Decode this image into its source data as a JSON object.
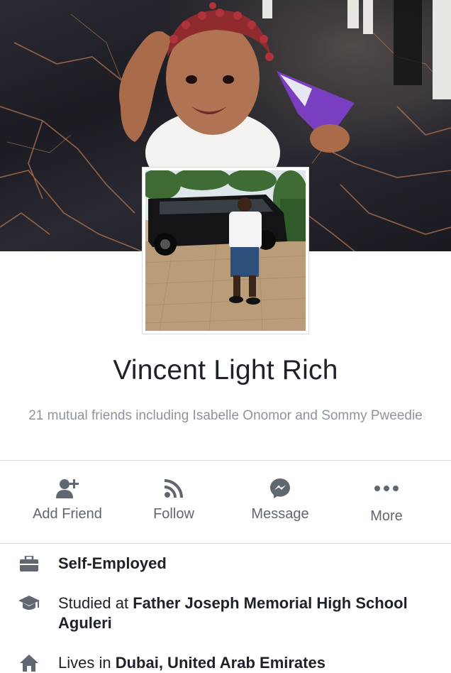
{
  "profile": {
    "name": "Vincent Light Rich",
    "mutual_friends": "21 mutual friends including Isabelle Onomor and Sommy Pweedie"
  },
  "actions": [
    {
      "label": "Add Friend",
      "icon": "add-friend-icon"
    },
    {
      "label": "Follow",
      "icon": "rss-icon"
    },
    {
      "label": "Message",
      "icon": "messenger-icon"
    },
    {
      "label": "More",
      "icon": "more-dots-icon"
    }
  ],
  "info": {
    "work": {
      "text": "Self-Employed",
      "icon": "briefcase-icon"
    },
    "education": {
      "prefix": "Studied at ",
      "value": "Father Joseph Memorial High School Aguleri",
      "icon": "graduation-cap-icon"
    },
    "lives": {
      "prefix": "Lives in ",
      "value": "Dubai, United Arab Emirates",
      "icon": "home-icon"
    }
  },
  "colors": {
    "icon_gray": "#606770",
    "secondary_text": "#8d949e",
    "divider": "#dadde1"
  }
}
